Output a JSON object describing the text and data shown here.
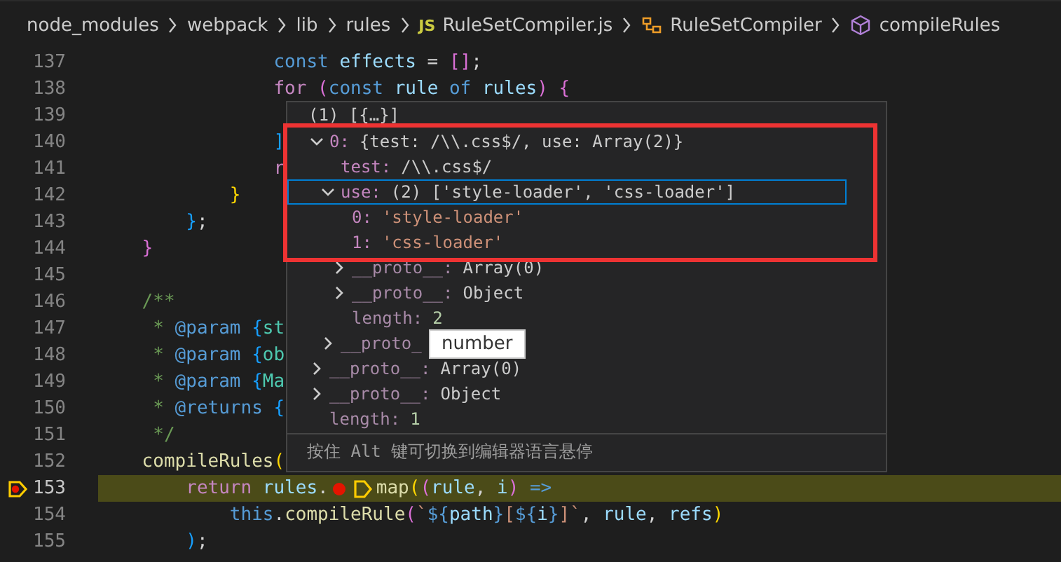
{
  "breadcrumb": [
    {
      "label": "node_modules",
      "kind": "folder"
    },
    {
      "label": "webpack",
      "kind": "folder"
    },
    {
      "label": "lib",
      "kind": "folder"
    },
    {
      "label": "rules",
      "kind": "folder"
    },
    {
      "label": "RuleSetCompiler.js",
      "kind": "file",
      "icon_text": "JS"
    },
    {
      "label": "RuleSetCompiler",
      "kind": "class"
    },
    {
      "label": "compileRules",
      "kind": "method"
    }
  ],
  "code_lines": [
    {
      "number": "137",
      "current": false,
      "tokens": [
        {
          "t": "                const ",
          "kind": "storage"
        },
        {
          "t": "effects",
          "kind": "var"
        },
        {
          "t": " = ",
          "kind": "plain"
        },
        {
          "t": "[]",
          "kind": "b2"
        },
        {
          "t": ";",
          "kind": "plain"
        }
      ]
    },
    {
      "number": "138",
      "current": false,
      "tokens": [
        {
          "t": "                for ",
          "kind": "keyword"
        },
        {
          "t": "(",
          "kind": "b2"
        },
        {
          "t": "const ",
          "kind": "storage"
        },
        {
          "t": "rule ",
          "kind": "var"
        },
        {
          "t": "of ",
          "kind": "storage"
        },
        {
          "t": "rules",
          "kind": "var"
        },
        {
          "t": ") {",
          "kind": "b2"
        }
      ]
    },
    {
      "number": "139",
      "current": false
    },
    {
      "number": "140",
      "current": false,
      "tokens": [
        {
          "t": "                ]",
          "kind": "b3"
        }
      ]
    },
    {
      "number": "141",
      "current": false,
      "tokens": [
        {
          "t": "                r",
          "kind": "keyword"
        }
      ]
    },
    {
      "number": "142",
      "current": false,
      "tokens": [
        {
          "t": "            }",
          "kind": "b1"
        }
      ]
    },
    {
      "number": "143",
      "current": false,
      "tokens": [
        {
          "t": "        }",
          "kind": "b3"
        },
        {
          "t": ";",
          "kind": "plain"
        }
      ]
    },
    {
      "number": "144",
      "current": false,
      "tokens": [
        {
          "t": "    }",
          "kind": "b2"
        }
      ]
    },
    {
      "number": "145",
      "current": false
    },
    {
      "number": "146",
      "current": false,
      "tokens": [
        {
          "t": "    /**",
          "kind": "comment"
        }
      ]
    },
    {
      "number": "147",
      "current": false,
      "tokens": [
        {
          "t": "     * ",
          "kind": "comment"
        },
        {
          "t": "@param ",
          "kind": "storage"
        },
        {
          "t": "{",
          "kind": "b3"
        },
        {
          "t": "st",
          "kind": "type"
        }
      ]
    },
    {
      "number": "148",
      "current": false,
      "tokens": [
        {
          "t": "     * ",
          "kind": "comment"
        },
        {
          "t": "@param ",
          "kind": "storage"
        },
        {
          "t": "{",
          "kind": "b3"
        },
        {
          "t": "ob",
          "kind": "type"
        }
      ]
    },
    {
      "number": "149",
      "current": false,
      "tokens": [
        {
          "t": "     * ",
          "kind": "comment"
        },
        {
          "t": "@param ",
          "kind": "storage"
        },
        {
          "t": "{",
          "kind": "b3"
        },
        {
          "t": "Ma",
          "kind": "type"
        }
      ]
    },
    {
      "number": "150",
      "current": false,
      "tokens": [
        {
          "t": "     * ",
          "kind": "comment"
        },
        {
          "t": "@returns ",
          "kind": "storage"
        },
        {
          "t": "{",
          "kind": "b3"
        }
      ]
    },
    {
      "number": "151",
      "current": false,
      "tokens": [
        {
          "t": "     */",
          "kind": "comment"
        }
      ]
    },
    {
      "number": "152",
      "current": false,
      "tokens": [
        {
          "t": "    compileRules",
          "kind": "func"
        },
        {
          "t": "(",
          "kind": "b1"
        }
      ]
    },
    {
      "number": "153",
      "current": true,
      "tokens": [
        {
          "t": "        return ",
          "kind": "keyword"
        },
        {
          "t": "rules",
          "kind": "var"
        },
        {
          "t": ".",
          "kind": "plain"
        },
        {
          "kind": "breakpoint-dot"
        },
        {
          "kind": "stop-marker"
        },
        {
          "t": "map",
          "kind": "func"
        },
        {
          "t": "(",
          "kind": "b1"
        },
        {
          "t": "(",
          "kind": "b2"
        },
        {
          "t": "rule",
          "kind": "var"
        },
        {
          "t": ", ",
          "kind": "plain"
        },
        {
          "t": "i",
          "kind": "var"
        },
        {
          "t": ")",
          "kind": "b2"
        },
        {
          "t": " =>",
          "kind": "storage"
        }
      ]
    },
    {
      "number": "154",
      "current": false,
      "tokens": [
        {
          "t": "            this",
          "kind": "storage"
        },
        {
          "t": ".",
          "kind": "plain"
        },
        {
          "t": "compileRule",
          "kind": "func"
        },
        {
          "t": "(",
          "kind": "b2"
        },
        {
          "t": "`",
          "kind": "string"
        },
        {
          "t": "${",
          "kind": "storage"
        },
        {
          "t": "path",
          "kind": "var"
        },
        {
          "t": "}",
          "kind": "storage"
        },
        {
          "t": "[",
          "kind": "string"
        },
        {
          "t": "${",
          "kind": "storage"
        },
        {
          "t": "i",
          "kind": "var"
        },
        {
          "t": "}",
          "kind": "storage"
        },
        {
          "t": "]`",
          "kind": "string"
        },
        {
          "t": ", ",
          "kind": "plain"
        },
        {
          "t": "rule",
          "kind": "var"
        },
        {
          "t": ", ",
          "kind": "plain"
        },
        {
          "t": "refs",
          "kind": "var"
        },
        {
          "t": ")",
          "kind": "b1"
        }
      ]
    },
    {
      "number": "155",
      "current": false,
      "tokens": [
        {
          "t": "        )",
          "kind": "b3"
        },
        {
          "t": ";",
          "kind": "plain"
        }
      ]
    }
  ],
  "hover": {
    "header": "(1) [{…}]",
    "nodes": [
      {
        "key": "0:",
        "value": "{test: /\\\\.css$/, use: Array(2)}",
        "kind": "other",
        "internal": false,
        "expanded": true,
        "selected": false,
        "children": [
          {
            "key": "test:",
            "value": "/\\\\.css$/",
            "kind": "other",
            "internal": false,
            "selected": false
          },
          {
            "key": "use:",
            "value": "(2) ['style-loader', 'css-loader']",
            "kind": "other",
            "internal": false,
            "expanded": true,
            "selected": true,
            "children": [
              {
                "key": "0:",
                "value": "'style-loader'",
                "kind": "string",
                "internal": false,
                "selected": false
              },
              {
                "key": "1:",
                "value": "'css-loader'",
                "kind": "string",
                "internal": false,
                "selected": false
              },
              {
                "key": "__proto__:",
                "value": "Array(0)",
                "kind": "other",
                "internal": true,
                "expanded": false,
                "selected": false
              },
              {
                "key": "__proto__:",
                "value": "Object",
                "kind": "other",
                "internal": true,
                "expanded": false,
                "selected": false
              },
              {
                "key": "length:",
                "value": "2",
                "kind": "number",
                "internal": true,
                "selected": false
              }
            ]
          },
          {
            "key": "__proto_",
            "internal": true,
            "expanded": false,
            "selected": false
          }
        ]
      },
      {
        "key": "__proto__:",
        "value": "Array(0)",
        "kind": "other",
        "internal": true,
        "expanded": false,
        "selected": false
      },
      {
        "key": "__proto__:",
        "value": "Object",
        "kind": "other",
        "internal": true,
        "expanded": false,
        "selected": false
      },
      {
        "key": "length:",
        "value": "1",
        "kind": "number",
        "internal": true,
        "selected": false
      }
    ],
    "footer": "按住 Alt 键可切换到编辑器语言悬停"
  },
  "tooltip": "number"
}
